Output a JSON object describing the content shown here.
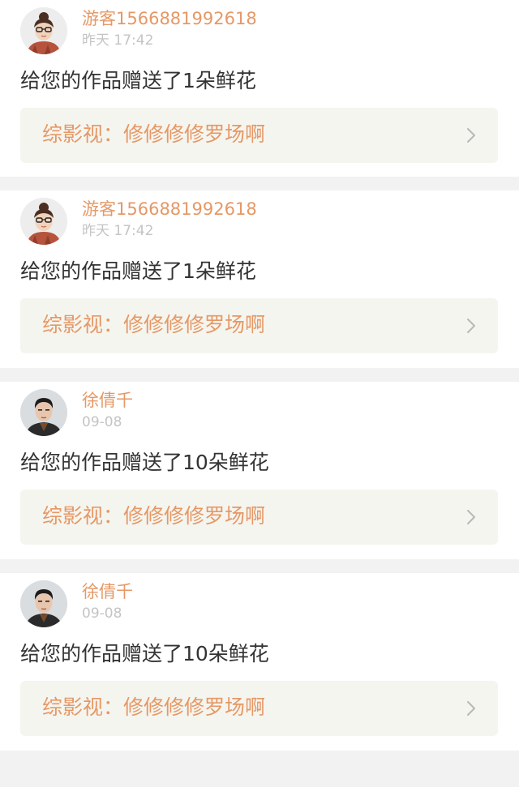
{
  "feed": {
    "items": [
      {
        "avatar": "woman-glasses-avatar",
        "username": "游客1566881992618",
        "time": "昨天 17:42",
        "message": "给您的作品赠送了1朵鲜花",
        "work_label": "综影视：修修修修罗场啊",
        "chevron": "chevron-right-icon"
      },
      {
        "avatar": "woman-glasses-avatar",
        "username": "游客1566881992618",
        "time": "昨天 17:42",
        "message": "给您的作品赠送了1朵鲜花",
        "work_label": "综影视：修修修修罗场啊",
        "chevron": "chevron-right-icon"
      },
      {
        "avatar": "man-portrait-avatar",
        "username": "徐倩千",
        "time": "09-08",
        "message": "给您的作品赠送了10朵鲜花",
        "work_label": "综影视：修修修修罗场啊",
        "chevron": "chevron-right-icon"
      },
      {
        "avatar": "man-portrait-avatar",
        "username": "徐倩千",
        "time": "09-08",
        "message": "给您的作品赠送了10朵鲜花",
        "work_label": "综影视：修修修修罗场啊",
        "chevron": "chevron-right-icon"
      }
    ]
  },
  "colors": {
    "accent": "#e59866",
    "text": "#333333",
    "muted": "#c4c4c4",
    "link_bg": "#f5f5ef",
    "page_bg": "#f2f2f2"
  }
}
